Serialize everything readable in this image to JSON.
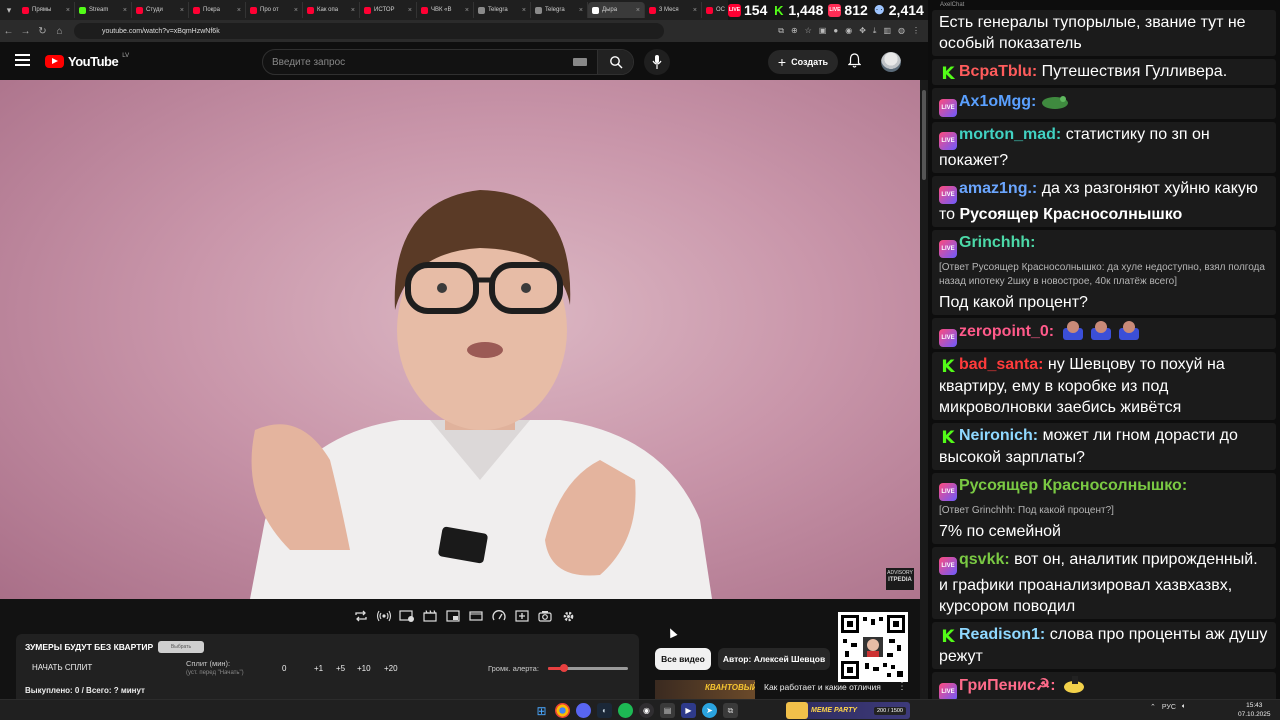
{
  "browser": {
    "tabs": [
      {
        "label": "Прямы",
        "color": "#ff0033"
      },
      {
        "label": "Stream",
        "color": "#53fc18"
      },
      {
        "label": "Студи",
        "color": "#ff0033"
      },
      {
        "label": "Покра",
        "color": "#ff0033"
      },
      {
        "label": "Про от",
        "color": "#ff0033"
      },
      {
        "label": "Как опа",
        "color": "#ff0033"
      },
      {
        "label": "ИСТОР",
        "color": "#ff0033"
      },
      {
        "label": "ЧВК «В",
        "color": "#ff0033"
      },
      {
        "label": "Telegra",
        "color": "#8a8a8a"
      },
      {
        "label": "Telegra",
        "color": "#8a8a8a"
      },
      {
        "label": "Дыра",
        "color": "#ffffff"
      },
      {
        "label": "3 Меся",
        "color": "#ff0033"
      },
      {
        "label": "ОС",
        "color": "#ff0033"
      }
    ],
    "url": "youtube.com/watch?v=xBqmHzwNf6k"
  },
  "youtube": {
    "logo_text": "YouTube",
    "country_code": "LV",
    "search_placeholder": "Введите запрос",
    "create_label": "Создать"
  },
  "video": {
    "watermark_top": "ADVISORY",
    "watermark_brand": "ITPEDIA"
  },
  "overlay_panel": {
    "title": "ЗУМЕРЫ БУДУТ БЕЗ КВАРТИР",
    "badge": "Выбрать",
    "start_split": "НАЧАТЬ СПЛИТ",
    "split_label": "Сплит (мин):",
    "split_sub": "(уст. перед \"Начать\")",
    "split_values": [
      "0",
      "+1",
      "+5",
      "+10",
      "+20"
    ],
    "alert_label": "Громк. алерта:",
    "alert_volume": 0.2,
    "stats": "Выкуплено: 0 / Всего: ? минут"
  },
  "chips": {
    "all": "Все видео",
    "author": "Автор: Алексей Шевцов"
  },
  "recommendation": {
    "thumb_text": "КВАНТОВЫЙ",
    "title": "Как работает и какие отличия"
  },
  "counters": [
    {
      "kind": "yt",
      "icon": "youtube-live-icon",
      "value": "154"
    },
    {
      "kind": "kick",
      "icon": "kick-icon",
      "value": "1,448"
    },
    {
      "kind": "vk",
      "icon": "vk-live-icon",
      "value": "812"
    },
    {
      "kind": "people",
      "icon": "viewers-icon",
      "value": "2,414"
    }
  ],
  "chat": {
    "app_title": "AxelChat",
    "messages": [
      {
        "source": "",
        "user": "",
        "user_color": "#ffffff",
        "reply": "",
        "text": "Есть генералы тупорылые, звание тут не особый показатель",
        "emotes": 0
      },
      {
        "source": "kick",
        "user": "BcpaTblu:",
        "user_color": "#ff5c5c",
        "reply": "",
        "text": "Путешествия Гулливера.",
        "emotes": 0
      },
      {
        "source": "vk",
        "user": "Ax1oMgg:",
        "user_color": "#5aa0ff",
        "reply": "",
        "text": "",
        "emotes": 1
      },
      {
        "source": "vk",
        "user": "morton_mad:",
        "user_color": "#41d1c2",
        "reply": "",
        "text": "статистику по зп он покажет?",
        "emotes": 0
      },
      {
        "source": "vk",
        "user": "amaz1ng.:",
        "user_color": "#6ba6ff",
        "reply": "",
        "text": "да хз разгоняют хуйню какую то",
        "highlight": "Русоящер Красносолнышко",
        "emotes": 0
      },
      {
        "source": "vk",
        "user": "Grinchhh:",
        "user_color": "#4cd9a8",
        "reply": "[Ответ Русоящер Красносолнышко: да хуле недоступно, взял полгода назад ипотеку 2шку в новострое, 40к платёж всего]",
        "text": "Под какой процент?",
        "emotes": 0
      },
      {
        "source": "vk",
        "user": "zeropoint_0:",
        "user_color": "#ff5a8a",
        "reply": "",
        "text": "",
        "emotes": 3
      },
      {
        "source": "kick",
        "user": "bad_santa:",
        "user_color": "#ff3b3b",
        "reply": "",
        "text": "ну Шевцову то похуй на квартиру, ему в коробке из под микроволновки заебись живётся",
        "emotes": 0
      },
      {
        "source": "kick",
        "user": "Neironich:",
        "user_color": "#8fd8ff",
        "reply": "",
        "text": "может ли гном дорасти до высокой зарплаты?",
        "emotes": 0
      },
      {
        "source": "vk",
        "user": "Русоящер Красносолнышко:",
        "user_color": "#7ac943",
        "reply": "[Ответ Grinchhh: Под какой процент?]",
        "text": "7% по семейной",
        "emotes": 0
      },
      {
        "source": "vk",
        "user": "qsvkk:",
        "user_color": "#7ac943",
        "reply": "",
        "text": "вот он, аналитик прирожденный. и графики проанализировал хазвхазвх, курсором поводил",
        "emotes": 0
      },
      {
        "source": "kick",
        "user": "Readison1:",
        "user_color": "#8fd8ff",
        "reply": "",
        "text": "слова про проценты аж душу режут",
        "emotes": 0
      },
      {
        "source": "vk",
        "user": "ГриПенис☭:",
        "user_color": "#ff6b8a",
        "reply": "",
        "text": "",
        "emotes": 1
      }
    ]
  },
  "taskbar": {
    "promo_name": "MEME PARTY",
    "promo_count": "200 / 1500",
    "lang": "РУС",
    "time": "15:43",
    "date": "07.10.2025"
  }
}
